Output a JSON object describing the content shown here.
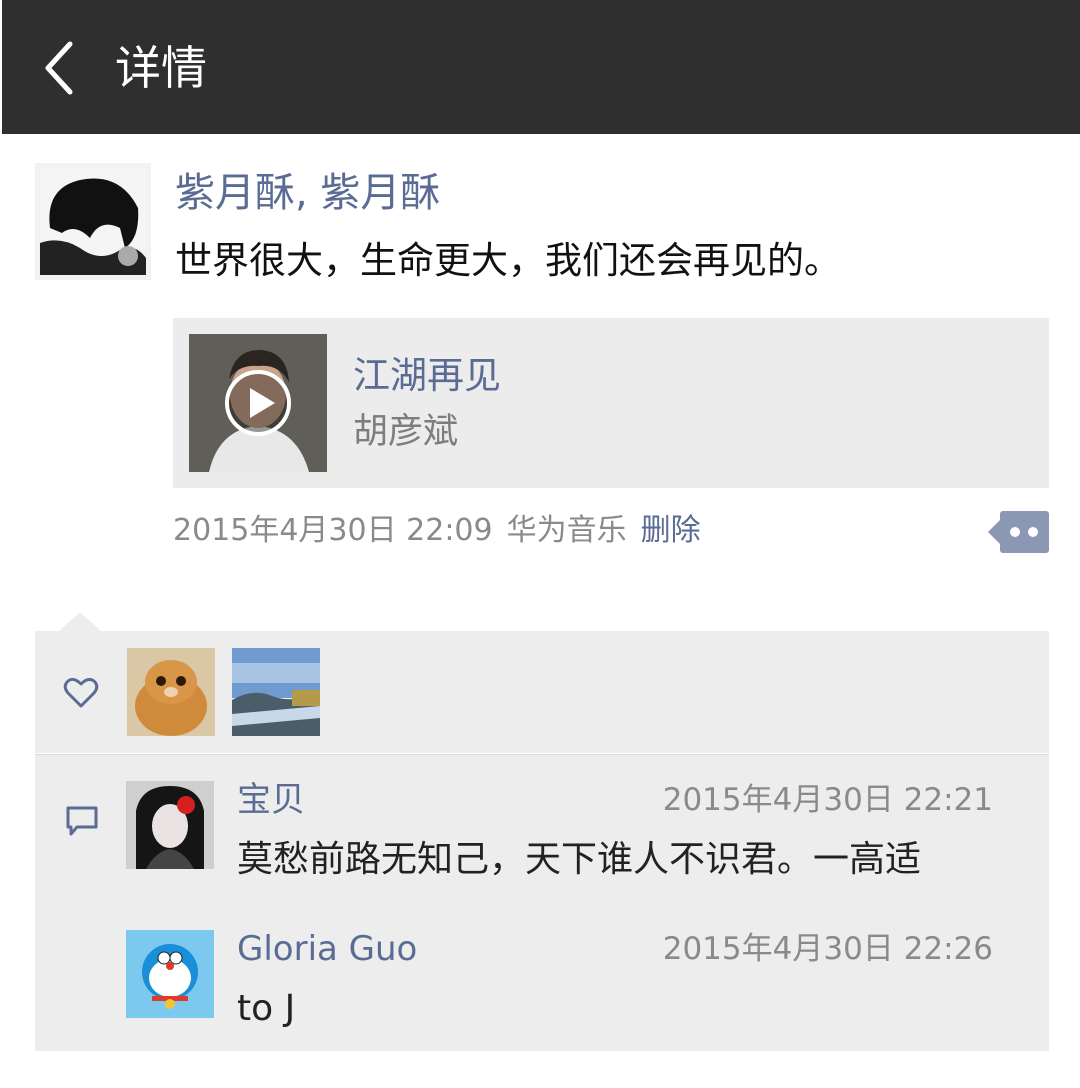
{
  "header": {
    "title": "详情",
    "back_icon": "chevron-left-icon"
  },
  "post": {
    "author": "紫月酥, 紫月酥",
    "text": "世界很大，生命更大，我们还会再见的。",
    "music": {
      "title": "江湖再见",
      "artist": "胡彦斌"
    },
    "timestamp": "2015年4月30日 22:09",
    "source": "华为音乐",
    "delete_label": "删除"
  },
  "likes": {
    "icon": "heart-icon",
    "count_avatars": 2
  },
  "comments": [
    {
      "name": "宝贝",
      "time": "2015年4月30日 22:21",
      "text": "莫愁前路无知己，天下谁人不识君。一高适"
    },
    {
      "name": "Gloria Guo",
      "time": "2015年4月30日 22:26",
      "text": "to J"
    }
  ],
  "colors": {
    "topbar": "#2f2f2f",
    "link": "#5a6c94",
    "panel": "#ededed"
  }
}
